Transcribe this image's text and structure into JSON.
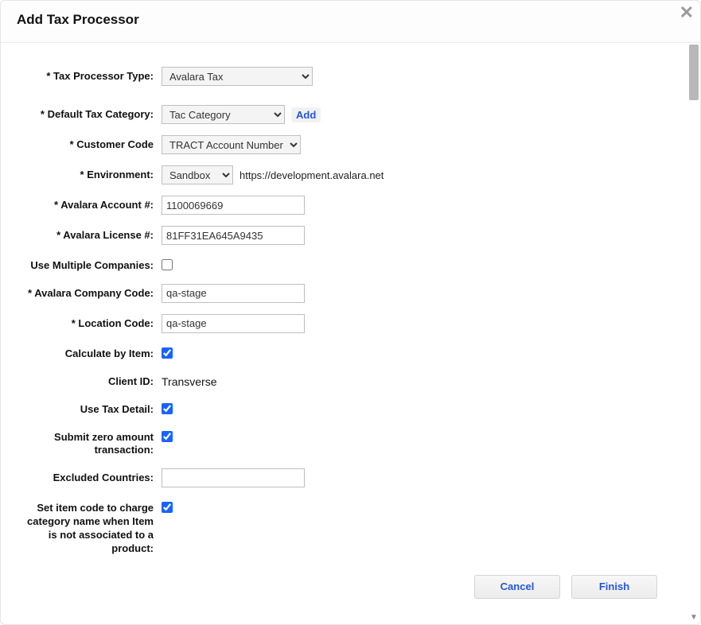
{
  "dialog": {
    "title": "Add Tax Processor"
  },
  "form": {
    "taxProcessorType": {
      "label": "Tax Processor Type:",
      "value": "Avalara Tax"
    },
    "defaultTaxCategory": {
      "label": "Default Tax Category:",
      "value": "Tac Category",
      "addLabel": "Add"
    },
    "customerCode": {
      "label": "Customer Code",
      "value": "TRACT Account Number"
    },
    "environment": {
      "label": "Environment:",
      "value": "Sandbox",
      "hint": "https://development.avalara.net"
    },
    "avalaraAccount": {
      "label": "Avalara Account #:",
      "value": "1100069669"
    },
    "avalaraLicense": {
      "label": "Avalara License #:",
      "value": "81FF31EA645A9435"
    },
    "useMultipleCompanies": {
      "label": "Use Multiple Companies:",
      "checked": false
    },
    "avalaraCompanyCode": {
      "label": "Avalara Company Code:",
      "value": "qa-stage"
    },
    "locationCode": {
      "label": "Location Code:",
      "value": "qa-stage"
    },
    "calculateByItem": {
      "label": "Calculate by Item:",
      "checked": true
    },
    "clientId": {
      "label": "Client ID:",
      "value": "Transverse"
    },
    "useTaxDetail": {
      "label": "Use Tax Detail:",
      "checked": true
    },
    "submitZeroAmount": {
      "label": "Submit zero amount transaction:",
      "checked": true
    },
    "excludedCountries": {
      "label": "Excluded Countries:",
      "value": ""
    },
    "setItemCodeFallback": {
      "label": "Set item code to charge category name when Item is not associated to a product:",
      "checked": true
    }
  },
  "actions": {
    "cancel": "Cancel",
    "finish": "Finish"
  }
}
